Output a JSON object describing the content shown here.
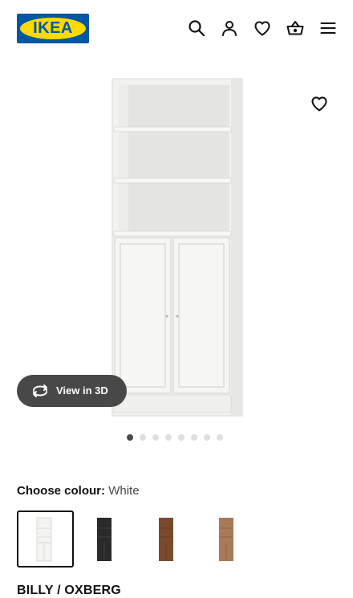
{
  "header": {
    "logo_text": "IKEA",
    "icons": [
      "search-icon",
      "user-icon",
      "heart-icon",
      "basket-icon",
      "menu-icon"
    ]
  },
  "hero": {
    "view3d_label": "View in 3D",
    "carousel": {
      "count": 8,
      "active_index": 0
    }
  },
  "colour": {
    "label": "Choose colour:",
    "value": "White",
    "options": [
      {
        "name": "white",
        "color": "#f4f4f2",
        "selected": true
      },
      {
        "name": "black-brown",
        "color": "#2a2a2a",
        "selected": false
      },
      {
        "name": "walnut",
        "color": "#7a4a2e",
        "selected": false
      },
      {
        "name": "oak",
        "color": "#a97a5a",
        "selected": false
      }
    ]
  },
  "product": {
    "name": "BILLY / OXBERG"
  },
  "colors": {
    "brand_blue": "#0058a3",
    "brand_yellow": "#ffdb00",
    "button_dark": "#484848"
  }
}
